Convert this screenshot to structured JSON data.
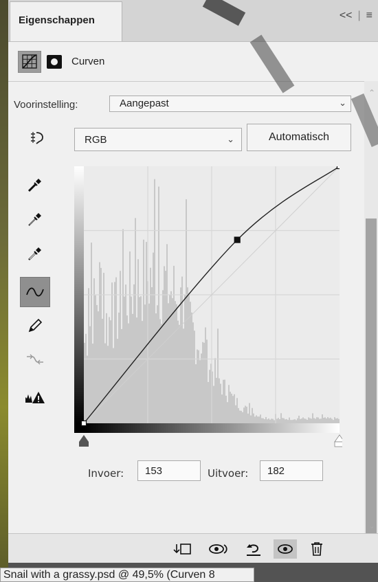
{
  "panel": {
    "tab_label": "Eigenschappen",
    "collapse_glyph": "<<",
    "menu_glyph": "≡",
    "adjustment_title": "Curven"
  },
  "preset": {
    "label": "Voorinstelling:",
    "value": "Aangepast"
  },
  "channel": {
    "value": "RGB",
    "auto_label": "Automatisch"
  },
  "tools": [
    {
      "icon": "on-image-adjust-icon"
    },
    {
      "icon": "black-point-eyedropper-icon"
    },
    {
      "icon": "gray-point-eyedropper-icon"
    },
    {
      "icon": "white-point-eyedropper-icon"
    },
    {
      "icon": "curve-point-tool-icon",
      "active": true
    },
    {
      "icon": "pencil-draw-icon"
    },
    {
      "icon": "smooth-curve-icon"
    },
    {
      "icon": "clipping-warning-icon"
    }
  ],
  "io": {
    "input_label": "Invoer:",
    "input_value": "153",
    "output_label": "Uitvoer:",
    "output_value": "182"
  },
  "bottom_icons": [
    "clip-to-layer-icon",
    "view-previous-state-icon",
    "reset-icon",
    "visibility-eye-icon",
    "delete-trash-icon"
  ],
  "document_tab": "Snail with a grassy.psd @ 49,5% (Curven 8",
  "colors": {
    "panel_bg": "#f0f0f0",
    "graph_bg": "#ebebeb",
    "histogram": "#c8c8c8",
    "curve": "#222222"
  },
  "chart_data": {
    "type": "line",
    "title": "",
    "xlabel": "",
    "ylabel": "",
    "xlim": [
      0,
      255
    ],
    "ylim": [
      0,
      255
    ],
    "grid": true,
    "control_points": [
      {
        "x": 0,
        "y": 0
      },
      {
        "x": 153,
        "y": 182
      },
      {
        "x": 255,
        "y": 255
      }
    ],
    "selected_point": {
      "x": 153,
      "y": 182
    },
    "baseline": [
      [
        0,
        0
      ],
      [
        255,
        255
      ]
    ]
  }
}
